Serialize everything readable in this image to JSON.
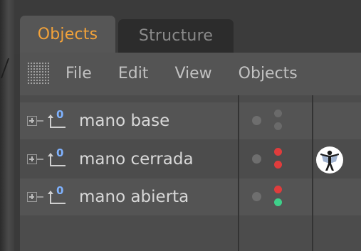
{
  "tabs": [
    {
      "label": "Objects",
      "active": true
    },
    {
      "label": "Structure",
      "active": false
    }
  ],
  "menu": {
    "items": [
      "File",
      "Edit",
      "View",
      "Objects"
    ]
  },
  "objects": [
    {
      "name": "mano base",
      "type_icon": "null-object-icon",
      "visibility_color": "#6e6e6e",
      "editor_state_color": "#6a6a6a",
      "render_state_color": "#6a6a6a",
      "tag": null
    },
    {
      "name": "mano cerrada",
      "type_icon": "null-object-icon",
      "visibility_color": "#6e6e6e",
      "editor_state_color": "#e03c3c",
      "render_state_color": "#e03c3c",
      "tag": "character-tag-icon"
    },
    {
      "name": "mano abierta",
      "type_icon": "null-object-icon",
      "visibility_color": "#6e6e6e",
      "editor_state_color": "#e03c3c",
      "render_state_color": "#3ed08a",
      "tag": null
    }
  ],
  "colors": {
    "active_tab_text": "#f2a23a",
    "inactive_tab_text": "#8a8a8a",
    "null_icon_accent": "#7fb2ff"
  }
}
